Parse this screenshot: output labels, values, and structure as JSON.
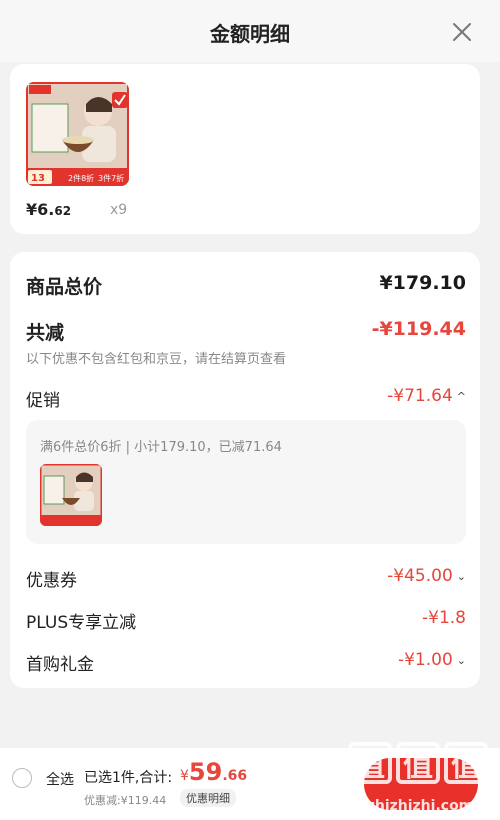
{
  "header": {
    "title": "金额明细"
  },
  "product": {
    "price_symbol": "¥",
    "price_int": "6.",
    "price_dec": "62",
    "quantity": "x9",
    "thumb_badge_left": "13",
    "thumb_badge_deal1": "2件8折",
    "thumb_badge_deal2": "3件7折"
  },
  "detail": {
    "total_label": "商品总价",
    "total_value": "¥179.10",
    "reduce_label": "共减",
    "reduce_value": "-¥119.44",
    "reduce_note": "以下优惠不包含红包和京豆，请在结算页查看",
    "promo_label": "促销",
    "promo_value": "-¥71.64",
    "promo_desc": "满6件总价6折 | 小计179.10，已减71.64",
    "coupon_label": "优惠券",
    "coupon_value": "-¥45.00",
    "plus_label": "PLUS专享立减",
    "plus_value": "-¥1.8",
    "gift_label": "首购礼金",
    "gift_value": "-¥1.00"
  },
  "bottom_bar": {
    "select_all": "全选",
    "selected_text": "已选1件,合计:",
    "total_symbol": "¥",
    "total_int": "59",
    "total_dec": ".66",
    "discount_text": "优惠减:¥119.44",
    "detail_button": "优惠明细"
  },
  "watermark": {
    "brand": "值",
    "site": "zhizhizhi.com"
  },
  "colors": {
    "accent": "#e8453c",
    "checkout": "#e8312b"
  }
}
